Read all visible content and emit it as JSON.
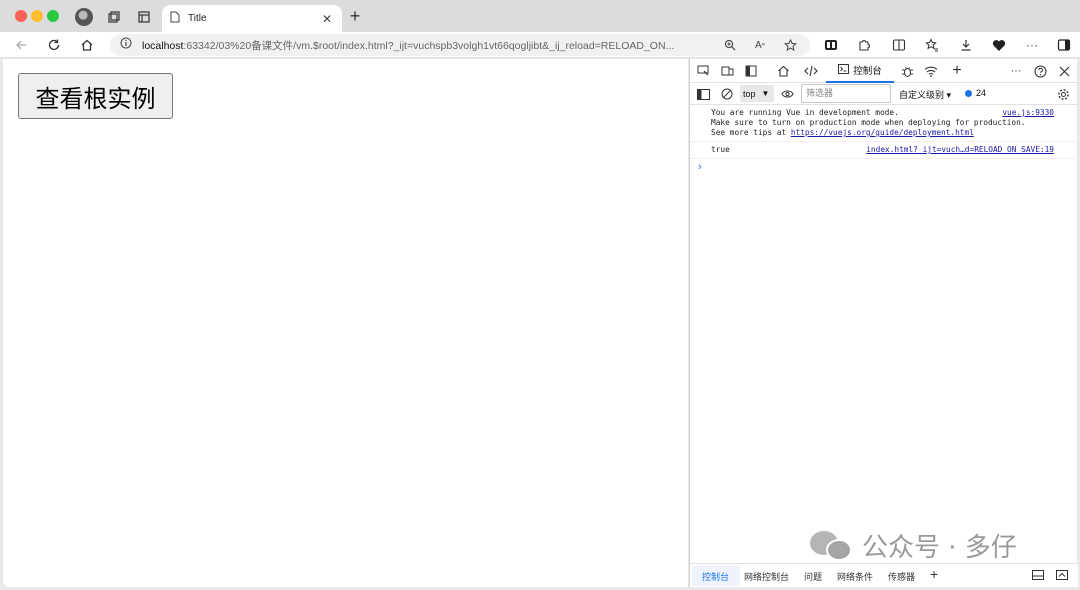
{
  "browser": {
    "tab_title": "Title",
    "url_host": "localhost",
    "url_rest": ":63342/03%20备课文件/vm.$root/index.html?_ijt=vuchspb3volgh1vt66qogljibt&_ij_reload=RELOAD_ON..."
  },
  "page": {
    "button_label": "查看根实例"
  },
  "devtools": {
    "console_tab_label": "控制台",
    "context_value": "top",
    "filter_placeholder": "筛选器",
    "levels_label": "自定义级别 ▾",
    "message_count": "24",
    "logs": [
      {
        "line1": "You are running Vue in development mode.",
        "line2": "Make sure to turn on production mode when deploying for production.",
        "line3_prefix": "See more tips at ",
        "link": "https://vuejs.org/guide/deployment.html",
        "source": "vue.js:9330"
      },
      {
        "text": "true",
        "source": "index.html?_ijt=vuch…d=RELOAD_ON_SAVE:19"
      }
    ],
    "drawer_tabs": [
      "控制台",
      "网络控制台",
      "问题",
      "网络条件",
      "传感器"
    ]
  },
  "watermark": {
    "text": "公众号 · 多仔"
  },
  "colors": {
    "accent": "#1a73e8",
    "close": "#fe5f57",
    "minimize": "#febc2e",
    "maximize": "#28c840"
  }
}
